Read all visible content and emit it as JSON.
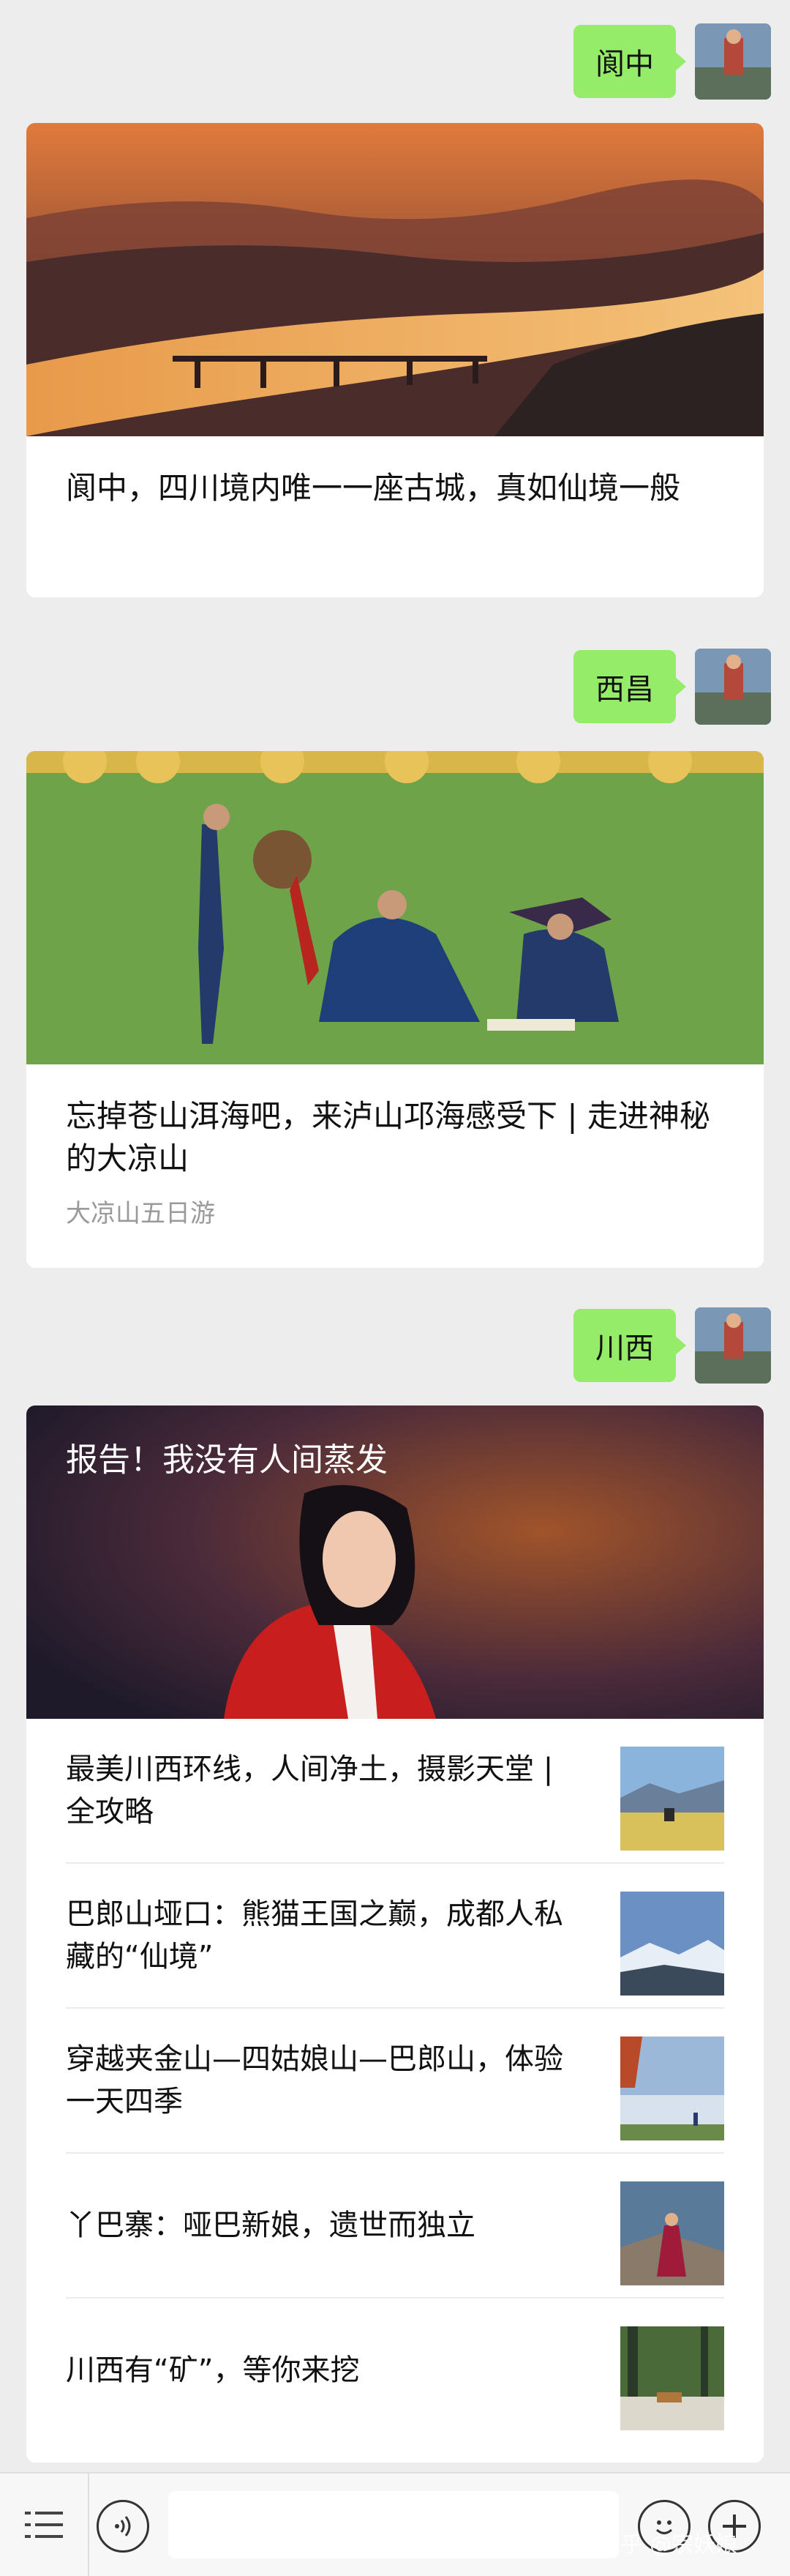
{
  "messages": [
    {
      "kind": "sent",
      "text": "阆中"
    },
    {
      "kind": "card",
      "title": "阆中，四川境内唯一一座古城，真如仙境一般"
    },
    {
      "kind": "sent",
      "text": "西昌"
    },
    {
      "kind": "card",
      "title": "忘掉苍山洱海吧，来泸山邛海感受下 | 走进神秘的大凉山",
      "subtitle": "大凉山五日游"
    },
    {
      "kind": "sent",
      "text": "川西"
    }
  ],
  "multi_card": {
    "hero_title": "报告！我没有人间蒸发",
    "items": [
      {
        "title": "最美川西环线，人间净土，摄影天堂 | 全攻略"
      },
      {
        "title": "巴郎山垭口：熊猫王国之巅，成都人私藏的“仙境”"
      },
      {
        "title": "穿越夹金山—四姑娘山—巴郎山，体验一天四季"
      },
      {
        "title": "丫巴寨：哑巴新娘，遗世而独立"
      },
      {
        "title": "川西有“矿”，等你来挖"
      }
    ]
  },
  "toolbar": {
    "watermark": "知乎 @宗妖娘"
  },
  "colors": {
    "bubble": "#95ec69",
    "background": "#ededed"
  }
}
